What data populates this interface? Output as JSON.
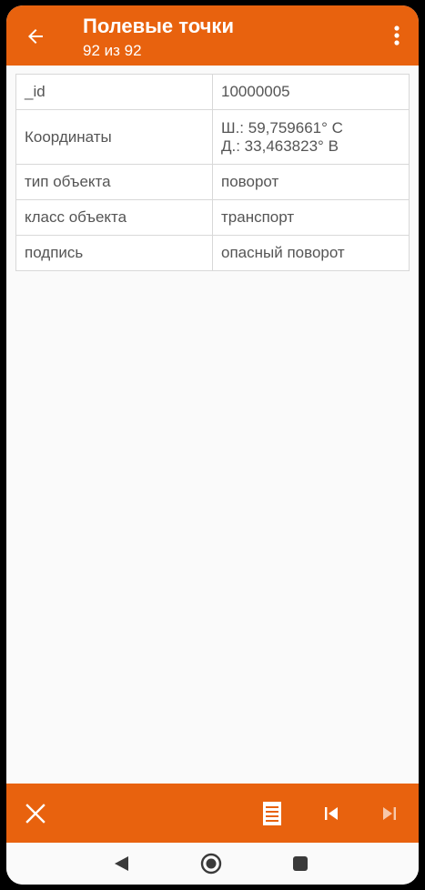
{
  "appbar": {
    "title": "Полевые точки",
    "subtitle": "92 из 92",
    "back_icon": "arrow-left-icon",
    "menu_icon": "more-vert-icon"
  },
  "attributes": [
    {
      "key": "_id",
      "value": "10000005"
    },
    {
      "key": "Координаты",
      "value_lines": [
        "Ш.: 59,759661° С",
        "Д.: 33,463823° В"
      ]
    },
    {
      "key": "тип объекта",
      "value": "поворот"
    },
    {
      "key": "класс объекта",
      "value": "транспорт"
    },
    {
      "key": "подпись",
      "value": "опасный поворот"
    }
  ],
  "bottombar": {
    "close_icon": "close-icon",
    "list_icon": "list-icon",
    "first_icon": "skip-previous-icon",
    "last_icon": "skip-next-icon"
  },
  "navbar": {
    "back_icon": "nav-back-icon",
    "home_icon": "nav-home-icon",
    "recents_icon": "nav-recents-icon"
  },
  "colors": {
    "accent": "#e8620e",
    "background": "#fafafa",
    "text": "#555555"
  }
}
